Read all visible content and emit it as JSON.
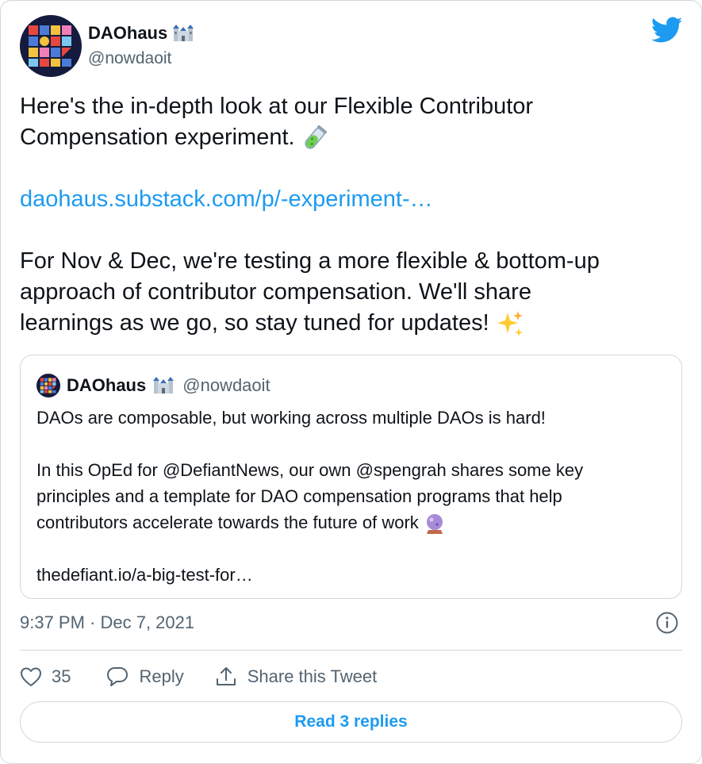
{
  "author": {
    "name": "DAOhaus",
    "handle": "@nowdaoit",
    "name_emoji": "castle-icon"
  },
  "tweet": {
    "lines": [
      "Here's the in-depth look at our Flexible Contributor",
      "Compensation experiment."
    ],
    "emoji_1": "test-tube-icon",
    "link": "daohaus.substack.com/p/-experiment-…",
    "body_lines": [
      "For Nov & Dec, we're testing a more flexible & bottom-up",
      "approach of contributor compensation. We'll share",
      "learnings as we go, so stay tuned for updates!"
    ],
    "emoji_2": "sparkles-icon"
  },
  "quoted": {
    "name": "DAOhaus",
    "handle": "@nowdaoit",
    "line1": "DAOs are composable, but working across multiple DAOs is hard!",
    "para_lines": [
      "In this OpEd for @DefiantNews, our own @spengrah shares some key",
      "principles and a template for DAO compensation programs that help",
      "contributors accelerate towards the future of work"
    ],
    "emoji": "crystal-ball-icon",
    "link": "thedefiant.io/a-big-test-for…"
  },
  "timestamp": "9:37 PM · Dec 7, 2021",
  "actions": {
    "like_count": "35",
    "reply_label": "Reply",
    "share_label": "Share this Tweet"
  },
  "read_replies_label": "Read 3 replies",
  "colors": {
    "link": "#1d9bf0",
    "secondary": "#536471",
    "border": "#cfd9de",
    "avatar_bg": "#141b3d"
  }
}
